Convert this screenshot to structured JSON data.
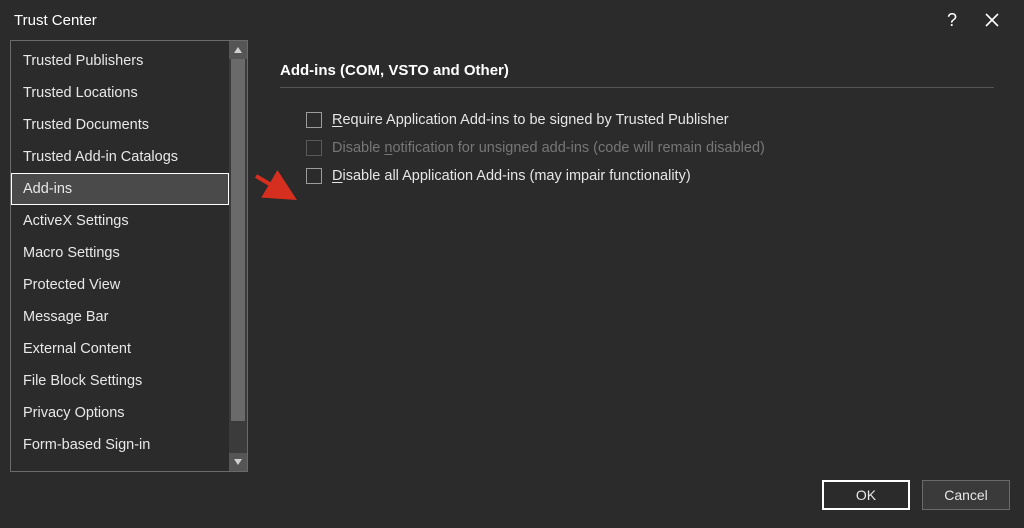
{
  "window": {
    "title": "Trust Center"
  },
  "sidebar": {
    "items": [
      "Trusted Publishers",
      "Trusted Locations",
      "Trusted Documents",
      "Trusted Add-in Catalogs",
      "Add-ins",
      "ActiveX Settings",
      "Macro Settings",
      "Protected View",
      "Message Bar",
      "External Content",
      "File Block Settings",
      "Privacy Options",
      "Form-based Sign-in"
    ],
    "selected_index": 4
  },
  "panel": {
    "section_title": "Add-ins (COM, VSTO and Other)",
    "options": [
      {
        "pre": "",
        "accel": "R",
        "post": "equire Application Add-ins to be signed by Trusted Publisher",
        "checked": false,
        "disabled": false
      },
      {
        "pre": "Disable ",
        "accel": "n",
        "post": "otification for unsigned add-ins (code will remain disabled)",
        "checked": false,
        "disabled": true
      },
      {
        "pre": "",
        "accel": "D",
        "post": "isable all Application Add-ins (may impair functionality)",
        "checked": false,
        "disabled": false
      }
    ]
  },
  "footer": {
    "ok": "OK",
    "cancel": "Cancel"
  }
}
